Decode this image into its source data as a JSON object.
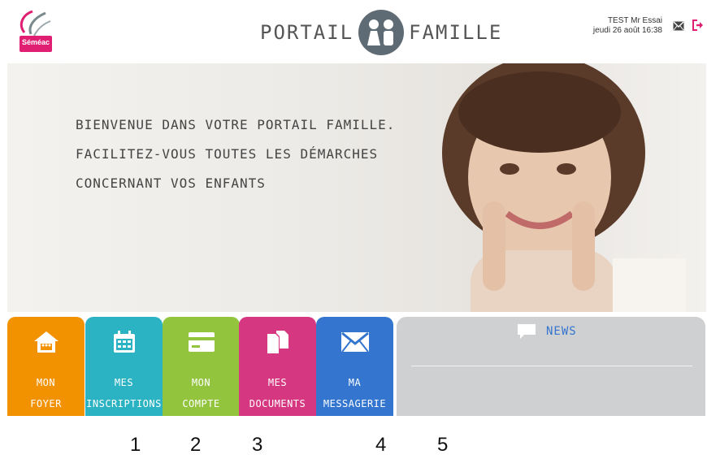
{
  "header": {
    "logo_text": "Séméac",
    "brand_left": "PORTAIL",
    "brand_right": "FAMILLE",
    "user_name": "TEST Mr Essai",
    "datetime": "jeudi 26 août 16:38"
  },
  "hero": {
    "lines": [
      "BIENVENUE DANS VOTRE PORTAIL FAMILLE.",
      "FACILITEZ-VOUS TOUTES LES DÉMARCHES",
      "CONCERNANT VOS ENFANTS"
    ]
  },
  "tiles": [
    {
      "line1": "MON",
      "line2": "FOYER",
      "color": "#f39200",
      "icon": "house-icon"
    },
    {
      "line1": "MES",
      "line2": "INSCRIPTIONS",
      "color": "#2bb3c3",
      "icon": "calendar-icon"
    },
    {
      "line1": "MON",
      "line2": "COMPTE",
      "color": "#93c43e",
      "icon": "card-icon"
    },
    {
      "line1": "MES",
      "line2": "DOCUMENTS",
      "color": "#d63781",
      "icon": "documents-icon"
    },
    {
      "line1": "MA",
      "line2": "MESSAGERIE",
      "color": "#3476cf",
      "icon": "envelope-icon"
    }
  ],
  "news": {
    "title": "NEWS",
    "color": "#3476cf"
  },
  "annotations": [
    "1",
    "2",
    "3",
    "4",
    "5"
  ]
}
